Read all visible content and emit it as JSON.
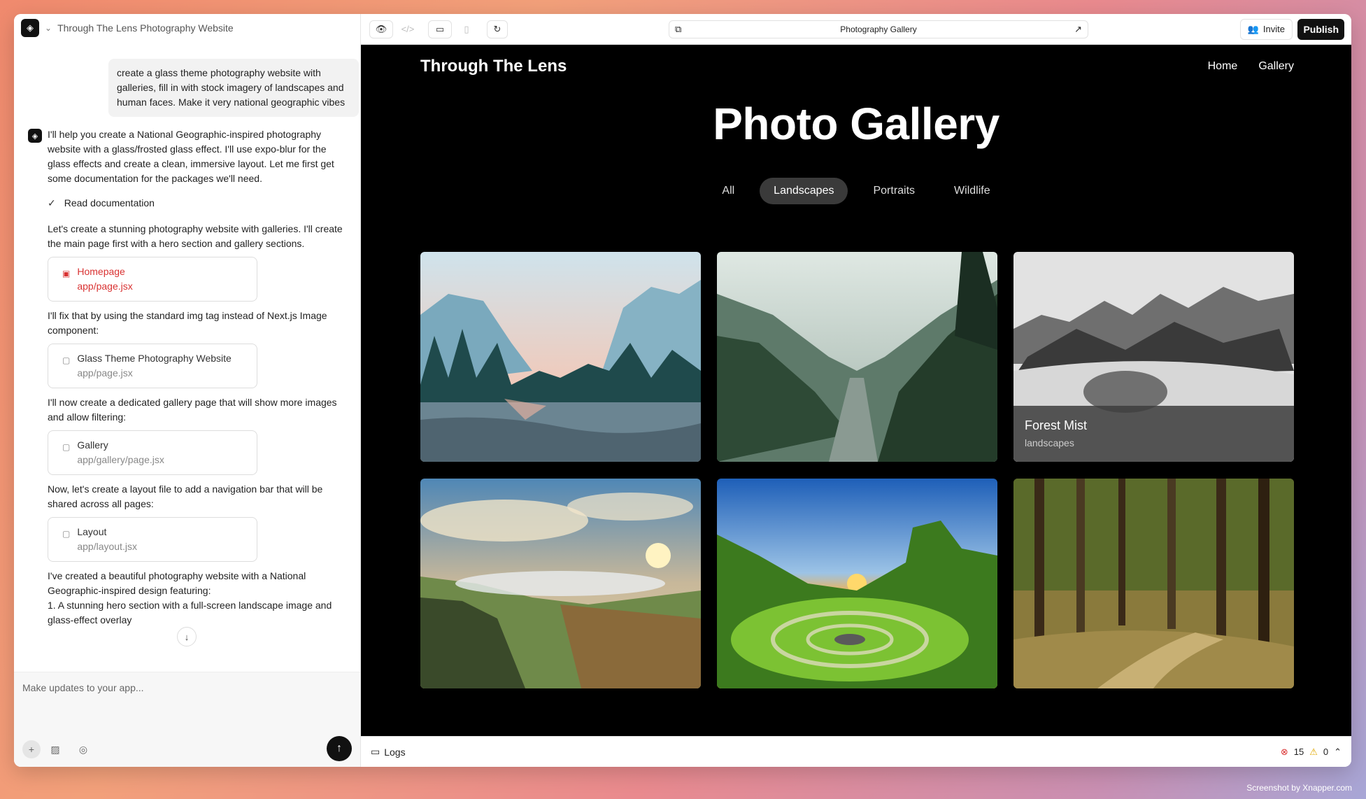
{
  "project": {
    "title": "Through The Lens Photography Website"
  },
  "chat": {
    "user_message": "create a glass theme photography website with galleries, fill in with stock imagery of landscapes and human faces. Make it very national geographic vibes",
    "assistant_intro": "I'll help you create a National Geographic-inspired photography website with a glass/frosted glass effect. I'll use expo-blur for the glass effects and create a clean, immersive layout. Let me first get some documentation for the packages we'll need.",
    "doc_step": "Read documentation",
    "msg_2": "Let's create a stunning photography website with galleries. I'll create the main page first with a hero section and gallery sections.",
    "card_1": {
      "title": "Homepage",
      "path": "app/page.jsx"
    },
    "msg_3": "I'll fix that by using the standard img tag instead of Next.js Image component:",
    "card_2": {
      "title": "Glass Theme Photography Website",
      "path": "app/page.jsx"
    },
    "msg_4": "I'll now create a dedicated gallery page that will show more images and allow filtering:",
    "card_3": {
      "title": "Gallery",
      "path": "app/gallery/page.jsx"
    },
    "msg_5": "Now, let's create a layout file to add a navigation bar that will be shared across all pages:",
    "card_4": {
      "title": "Layout",
      "path": "app/layout.jsx"
    },
    "msg_6": "I've created a beautiful photography website with a National Geographic-inspired design featuring:",
    "msg_7": "1. A stunning hero section with a full-screen landscape image and glass-effect overlay"
  },
  "composer": {
    "placeholder": "Make updates to your app..."
  },
  "toolbar": {
    "url_title": "Photography Gallery",
    "invite_label": "Invite",
    "publish_label": "Publish"
  },
  "site": {
    "brand": "Through The Lens",
    "nav": [
      "Home",
      "Gallery"
    ],
    "title": "Photo Gallery",
    "filters": [
      "All",
      "Landscapes",
      "Portraits",
      "Wildlife"
    ],
    "active_filter": "Landscapes",
    "hover_caption": {
      "title": "Forest Mist",
      "category": "landscapes"
    }
  },
  "logs": {
    "label": "Logs",
    "errors": "15",
    "warnings": "0"
  },
  "credit": "Screenshot by Xnapper.com"
}
